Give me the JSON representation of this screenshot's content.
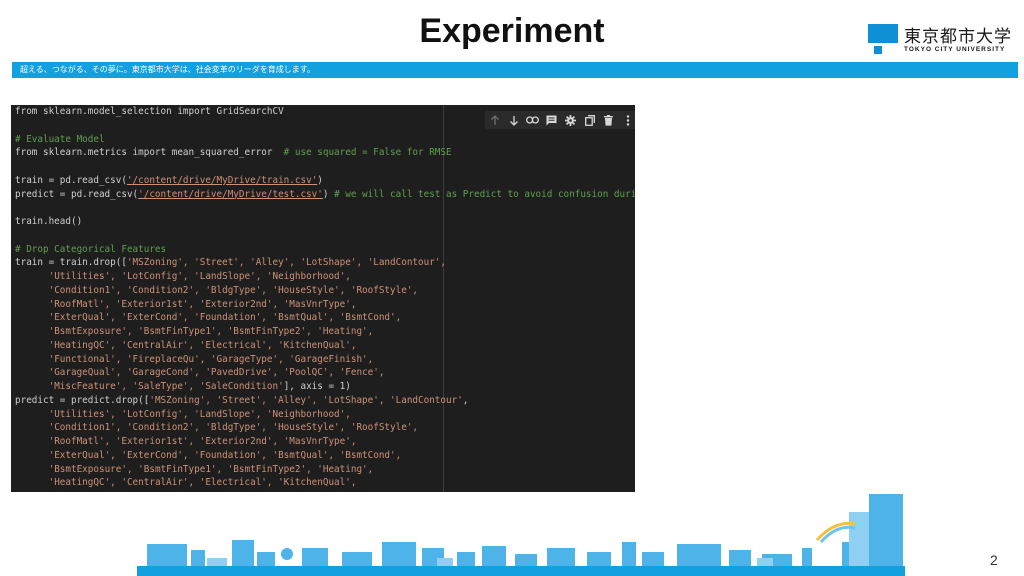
{
  "slide": {
    "title": "Experiment",
    "tagline": "超える、つながる、その夢に。東京都市大学は、社会変革のリーダを育成します。",
    "page_number": "2"
  },
  "logo": {
    "name_jp": "東京都市大学",
    "name_en": "TOKYO CITY UNIVERSITY",
    "color": "#0e8fd6"
  },
  "colors": {
    "band": "#12a0e0",
    "code_bg": "#1e1e1e",
    "comment": "#5fa04e",
    "string": "#ce9178"
  },
  "toolbar": {
    "icons": [
      "arrow-up-icon",
      "arrow-down-icon",
      "link-icon",
      "comment-icon",
      "gear-icon",
      "mirror-icon",
      "trash-icon",
      "more-icon"
    ]
  },
  "code": {
    "lines": [
      [
        {
          "t": "from sklearn.model_selection import GridSearchCV",
          "c": ""
        }
      ],
      [
        {
          "t": "",
          "c": ""
        }
      ],
      [
        {
          "t": "# Evaluate Model",
          "c": "cm"
        }
      ],
      [
        {
          "t": "from sklearn.metrics import mean_squared_error  ",
          "c": ""
        },
        {
          "t": "# use squared = False for RMSE",
          "c": "cm"
        }
      ],
      [
        {
          "t": "",
          "c": ""
        }
      ],
      [
        {
          "t": "train = pd.read_csv(",
          "c": ""
        },
        {
          "t": "'/content/drive/MyDrive/train.csv'",
          "c": "ul"
        },
        {
          "t": ")",
          "c": ""
        }
      ],
      [
        {
          "t": "predict = pd.read_csv(",
          "c": ""
        },
        {
          "t": "'/content/drive/MyDrive/test.csv'",
          "c": "ul"
        },
        {
          "t": ") ",
          "c": ""
        },
        {
          "t": "# we will call test as Predict to avoid confusion during tr",
          "c": "cm"
        }
      ],
      [
        {
          "t": "",
          "c": ""
        }
      ],
      [
        {
          "t": "train.head()",
          "c": ""
        }
      ],
      [
        {
          "t": "",
          "c": ""
        }
      ],
      [
        {
          "t": "# Drop Categorical Features",
          "c": "cm"
        }
      ],
      [
        {
          "t": "train = train.drop([",
          "c": ""
        },
        {
          "t": "'MSZoning', 'Street', 'Alley', 'LotShape', 'LandContour',",
          "c": "st"
        }
      ],
      [
        {
          "t": "      ",
          "c": ""
        },
        {
          "t": "'Utilities', 'LotConfig', 'LandSlope', 'Neighborhood',",
          "c": "st"
        }
      ],
      [
        {
          "t": "      ",
          "c": ""
        },
        {
          "t": "'Condition1', 'Condition2', 'BldgType', 'HouseStyle', 'RoofStyle',",
          "c": "st"
        }
      ],
      [
        {
          "t": "      ",
          "c": ""
        },
        {
          "t": "'RoofMatl', 'Exterior1st', 'Exterior2nd', 'MasVnrType',",
          "c": "st"
        }
      ],
      [
        {
          "t": "      ",
          "c": ""
        },
        {
          "t": "'ExterQual', 'ExterCond', 'Foundation', 'BsmtQual', 'BsmtCond',",
          "c": "st"
        }
      ],
      [
        {
          "t": "      ",
          "c": ""
        },
        {
          "t": "'BsmtExposure', 'BsmtFinType1', 'BsmtFinType2', 'Heating',",
          "c": "st"
        }
      ],
      [
        {
          "t": "      ",
          "c": ""
        },
        {
          "t": "'HeatingQC', 'CentralAir', 'Electrical', 'KitchenQual',",
          "c": "st"
        }
      ],
      [
        {
          "t": "      ",
          "c": ""
        },
        {
          "t": "'Functional', 'FireplaceQu', 'GarageType', 'GarageFinish',",
          "c": "st"
        }
      ],
      [
        {
          "t": "      ",
          "c": ""
        },
        {
          "t": "'GarageQual', 'GarageCond', 'PavedDrive', 'PoolQC', 'Fence',",
          "c": "st"
        }
      ],
      [
        {
          "t": "      ",
          "c": ""
        },
        {
          "t": "'MiscFeature', 'SaleType', 'SaleCondition'",
          "c": "st"
        },
        {
          "t": "], axis = 1)",
          "c": ""
        }
      ],
      [
        {
          "t": "predict = predict.drop([",
          "c": ""
        },
        {
          "t": "'MSZoning', 'Street', 'Alley', 'LotShape', 'LandContour'",
          "c": "st"
        },
        {
          "t": ",",
          "c": ""
        }
      ],
      [
        {
          "t": "      ",
          "c": ""
        },
        {
          "t": "'Utilities', 'LotConfig', 'LandSlope', 'Neighborhood',",
          "c": "st"
        }
      ],
      [
        {
          "t": "      ",
          "c": ""
        },
        {
          "t": "'Condition1', 'Condition2', 'BldgType', 'HouseStyle', 'RoofStyle',",
          "c": "st"
        }
      ],
      [
        {
          "t": "      ",
          "c": ""
        },
        {
          "t": "'RoofMatl', 'Exterior1st', 'Exterior2nd', 'MasVnrType',",
          "c": "st"
        }
      ],
      [
        {
          "t": "      ",
          "c": ""
        },
        {
          "t": "'ExterQual', 'ExterCond', 'Foundation', 'BsmtQual', 'BsmtCond',",
          "c": "st"
        }
      ],
      [
        {
          "t": "      ",
          "c": ""
        },
        {
          "t": "'BsmtExposure', 'BsmtFinType1', 'BsmtFinType2', 'Heating',",
          "c": "st"
        }
      ],
      [
        {
          "t": "      ",
          "c": ""
        },
        {
          "t": "'HeatingQC', 'CentralAir', 'Electrical', 'KitchenQual',",
          "c": "st"
        }
      ]
    ]
  }
}
